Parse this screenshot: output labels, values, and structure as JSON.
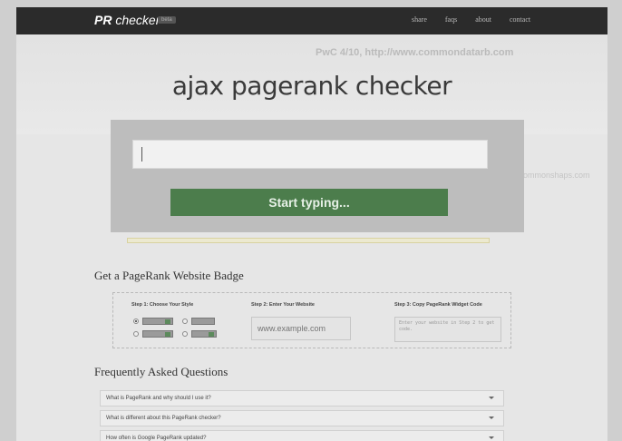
{
  "navbar": {
    "brand_strong": "PR",
    "brand_rest": " checker",
    "beta": "beta",
    "links": [
      "share",
      "faqs",
      "about",
      "contact"
    ]
  },
  "ghost": {
    "text": "PwC 4/10, http://www.commondatarb.com",
    "text2": "cut commonshaps.com"
  },
  "hero": {
    "title": "ajax pagerank checker",
    "input_value": "",
    "button_label": "Start typing..."
  },
  "badge": {
    "title": "Get a PageRank Website Badge",
    "step1": "Step 1: Choose Your Style",
    "step2": "Step 2: Enter Your Website",
    "step3": "Step 3: Copy PageRank Widget Code",
    "site_placeholder": "www.example.com",
    "code_placeholder": "Enter your website in Step 2 to get code."
  },
  "faq": {
    "title": "Frequently Asked Questions",
    "items": [
      "What is PageRank and why should I use it?",
      "What is different about this PageRank checker?",
      "How often is Google PageRank updated?"
    ]
  }
}
